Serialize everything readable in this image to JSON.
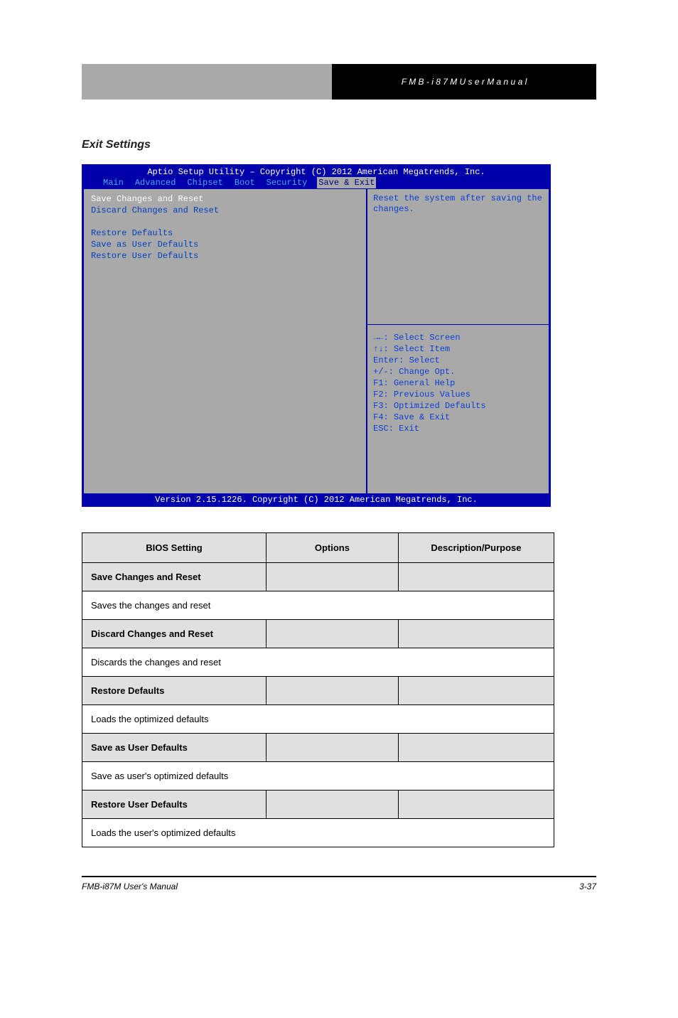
{
  "header": {
    "right_text": "F M B - i 8 7 M   U s e r   M a n u a l"
  },
  "section_title": "Exit Settings",
  "bios": {
    "title": "Aptio Setup Utility – Copyright (C) 2012 American Megatrends, Inc.",
    "tabs": [
      "Main",
      "Advanced",
      "Chipset",
      "Boot",
      "Security",
      "Save & Exit"
    ],
    "active_tab": "Save & Exit",
    "menu": {
      "block1": [
        "Save Changes and Reset",
        "Discard Changes and Reset"
      ],
      "block2": [
        "Restore Defaults",
        "Save as User Defaults",
        "Restore User Defaults"
      ]
    },
    "help_top": "Reset the system after saving the changes.",
    "help_bottom": [
      "→←: Select Screen",
      "↑↓: Select Item",
      "Enter: Select",
      "+/-: Change Opt.",
      "F1: General Help",
      "F2: Previous Values",
      "F3: Optimized Defaults",
      "F4: Save & Exit",
      "ESC: Exit"
    ],
    "footer": "Version 2.15.1226. Copyright (C) 2012 American Megatrends, Inc."
  },
  "table": {
    "header": [
      "BIOS Setting",
      "Options",
      "Description/Purpose"
    ],
    "rows": [
      {
        "title": "Save Changes and Reset",
        "desc": "Saves the changes and reset"
      },
      {
        "title": "Discard Changes and Reset",
        "desc": "Discards the changes and reset"
      },
      {
        "title": "Restore Defaults",
        "desc": "Loads the optimized defaults"
      },
      {
        "title": "Save as User Defaults",
        "desc": "Save as user's optimized defaults"
      },
      {
        "title": "Restore User Defaults",
        "desc": "Loads the user's optimized defaults"
      }
    ]
  },
  "footer": {
    "left": "FMB-i87M User's Manual",
    "right": "3-37"
  }
}
